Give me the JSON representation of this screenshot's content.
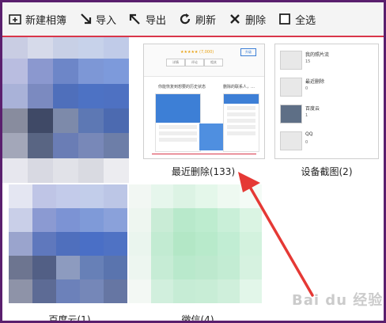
{
  "toolbar": {
    "new_album": "新建相簿",
    "import": "导入",
    "export": "导出",
    "refresh": "刷新",
    "delete": "删除",
    "select_all": "全选"
  },
  "albums": {
    "recently_deleted": {
      "label": "最近删除(133)"
    },
    "screenshots": {
      "label": "设备截图(2)"
    },
    "baidu_cloud": {
      "label": "百度云(1)"
    },
    "wechat": {
      "label": "微信(4)"
    }
  },
  "thumb1": {
    "stars": "★★★★★ (7,000)",
    "btn": "升级",
    "tabs": [
      "详情",
      "评论",
      "相关"
    ],
    "cap_left": "你能恢复到想要的历史状态",
    "cap_right": "删除的联系人，…"
  },
  "thumb2": {
    "items": [
      {
        "name": "我的照片流",
        "count": "15"
      },
      {
        "name": "最近删除",
        "count": "0"
      },
      {
        "name": "百度云",
        "count": "1"
      },
      {
        "name": "QQ",
        "count": "0"
      }
    ]
  },
  "watermark": "Bai du 经验",
  "colors": {
    "accent": "#d9364a",
    "frame": "#5a1f6e",
    "arrow": "#e53935"
  }
}
